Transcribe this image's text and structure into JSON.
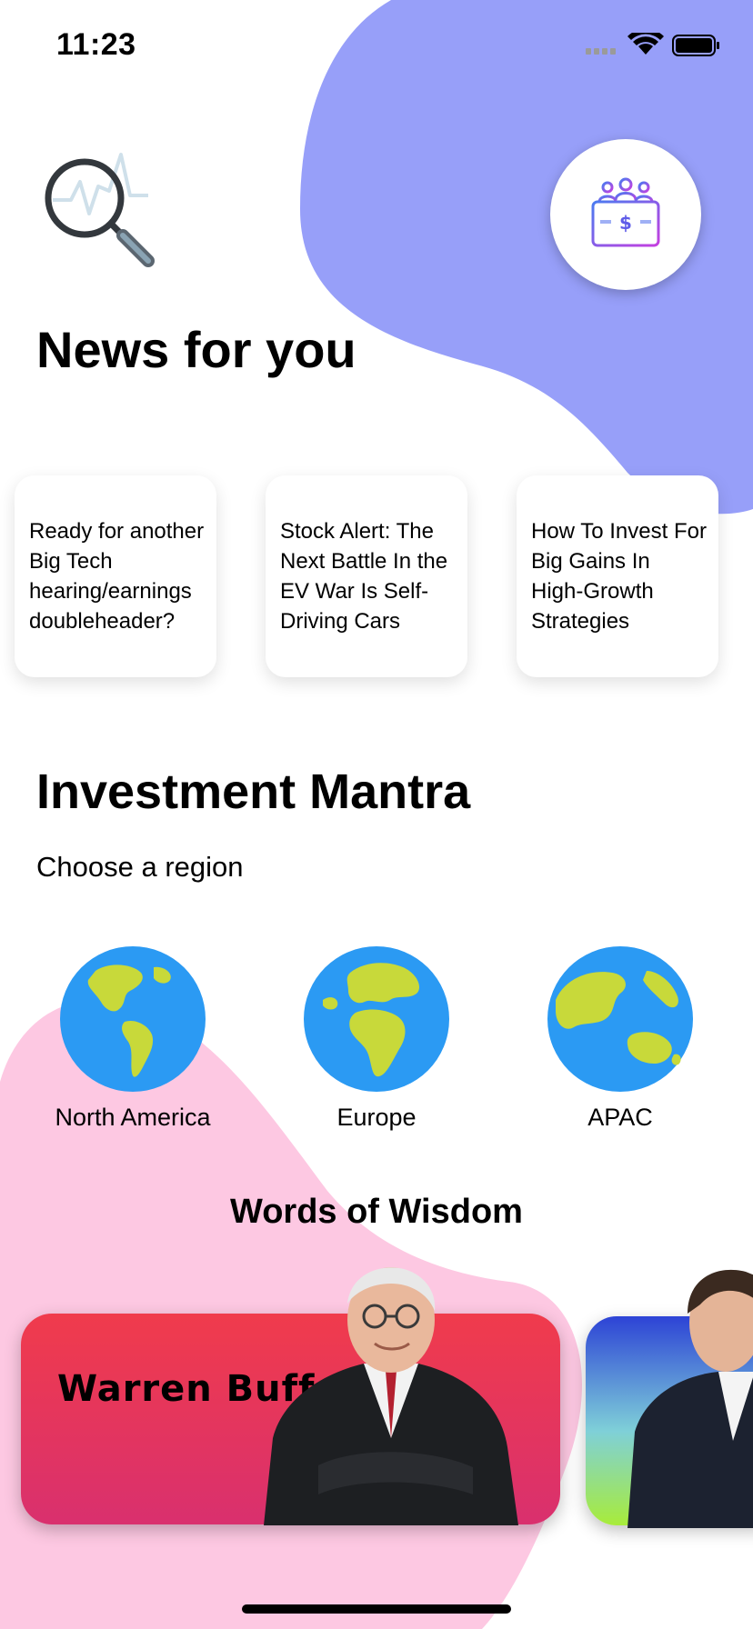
{
  "status_bar": {
    "time": "11:23"
  },
  "news": {
    "title": "News for you",
    "cards": [
      {
        "headline": "Ready for another Big Tech hearing/earnings doubleheader?"
      },
      {
        "headline": "Stock Alert: The Next Battle In the EV War Is Self-Driving Cars"
      },
      {
        "headline": "How To Invest For Big Gains In High-Growth Strategies"
      }
    ]
  },
  "mantra": {
    "title": "Investment Mantra",
    "subtitle": "Choose a region",
    "regions": [
      {
        "label": "North America",
        "icon": "globe-americas-icon"
      },
      {
        "label": "Europe",
        "icon": "globe-europe-africa-icon"
      },
      {
        "label": "APAC",
        "icon": "globe-asia-australia-icon"
      }
    ]
  },
  "wisdom": {
    "title": "Words of Wisdom",
    "cards": [
      {
        "name": "Warren Buffet"
      }
    ]
  },
  "colors": {
    "top_blob": "#979ff9",
    "bottom_blob": "#fdc8e2",
    "globe_ocean": "#2b9af3",
    "globe_land": "#c8d93a",
    "card_red": "#f03b4c"
  }
}
